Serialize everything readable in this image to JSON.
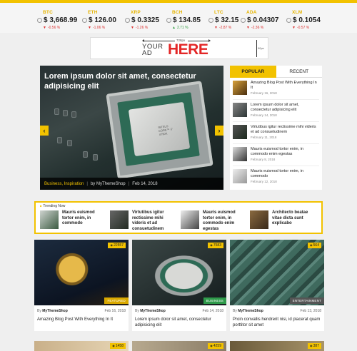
{
  "ticker": [
    {
      "symbol": "BTC",
      "price": "$ 3,668.99",
      "change": "-0.56 %",
      "dir": "down"
    },
    {
      "symbol": "ETH",
      "price": "$ 126.00",
      "change": "-1.06 %",
      "dir": "down"
    },
    {
      "symbol": "XRP",
      "price": "$ 0.3325",
      "change": "-1.26 %",
      "dir": "down"
    },
    {
      "symbol": "BCH",
      "price": "$ 134.85",
      "change": "2.71 %",
      "dir": "up"
    },
    {
      "symbol": "LTC",
      "price": "$ 32.15",
      "change": "-2.87 %",
      "dir": "down"
    },
    {
      "symbol": "ADA",
      "price": "$ 0.04307",
      "change": "-2.36 %",
      "dir": "down"
    },
    {
      "symbol": "XLM",
      "price": "$ 0.1054",
      "change": "-0.57 %",
      "dir": "down"
    }
  ],
  "ad": {
    "width_label": "728px",
    "your": "YOUR",
    "ad": "AD",
    "here": "HERE",
    "height_label": "90px"
  },
  "hero": {
    "title": "Lorem ipsum dolor sit amet, consectetur adipisicing elit",
    "categories": "Business, Inspiration",
    "author": "by MyThemeShop",
    "date": "Feb 14, 2018",
    "chip_text": "INTEL® CORE™ i7 4790K"
  },
  "sidebar": {
    "tabs": [
      {
        "label": "POPULAR"
      },
      {
        "label": "RECENT"
      }
    ],
    "items": [
      {
        "title": "Amazing Blog Post With Everything In It",
        "date": "February 16, 2018"
      },
      {
        "title": "Lorem ipsum dolor sit amet, consectetur adipisicing elit",
        "date": "February 14, 2018"
      },
      {
        "title": "Virtutibus igitur rectissime mihi videris et ad consuetudinem",
        "date": "February 11, 2018"
      },
      {
        "title": "Mauris euismod tortor enim, in commodo enim egestas",
        "date": "February 8, 2018"
      },
      {
        "title": "Mauris euismod tortor enim, in commodo",
        "date": "February 12, 2018"
      }
    ]
  },
  "trending": {
    "label": "Trending Now",
    "items": [
      {
        "title": "Mauris euismod tortor enim, in commodo"
      },
      {
        "title": "Virtutibus igitur rectissime mihi videris et ad consuetudinem"
      },
      {
        "title": "Mauris euismod tortor enim, in commodo enim egestas"
      },
      {
        "title": "Architecto beatae vitae dicta sunt explicabo"
      }
    ]
  },
  "cards": [
    {
      "views": "22557",
      "badge": "FEATURED",
      "badge_color": "#d9a800",
      "author": "MyThemeShop",
      "by": "By",
      "date": "Feb 16, 2018",
      "title": "Amazing Blog Post With Everything In It"
    },
    {
      "views": "7583",
      "badge": "BUSINESS",
      "badge_color": "#2e9a4a",
      "author": "MyThemeShop",
      "by": "By",
      "date": "Feb 14, 2018",
      "title": "Lorem ipsum dolor sit amet, consectetur adipisicing elit"
    },
    {
      "views": "564",
      "badge": "ENTERTAINMENT",
      "badge_color": "#555555",
      "author": "MyThemeShop",
      "by": "By",
      "date": "Feb 13, 2018",
      "title": "Proin convallis hendrerit nisi, id placerat quam porttitor sit amet"
    }
  ],
  "cards_row2": [
    {
      "views": "1458"
    },
    {
      "views": "4259"
    },
    {
      "views": "387"
    }
  ],
  "colors": {
    "accent": "#f2c200",
    "down": "#dd3333",
    "up": "#2a9a3a",
    "ad_here": "#e32626"
  }
}
